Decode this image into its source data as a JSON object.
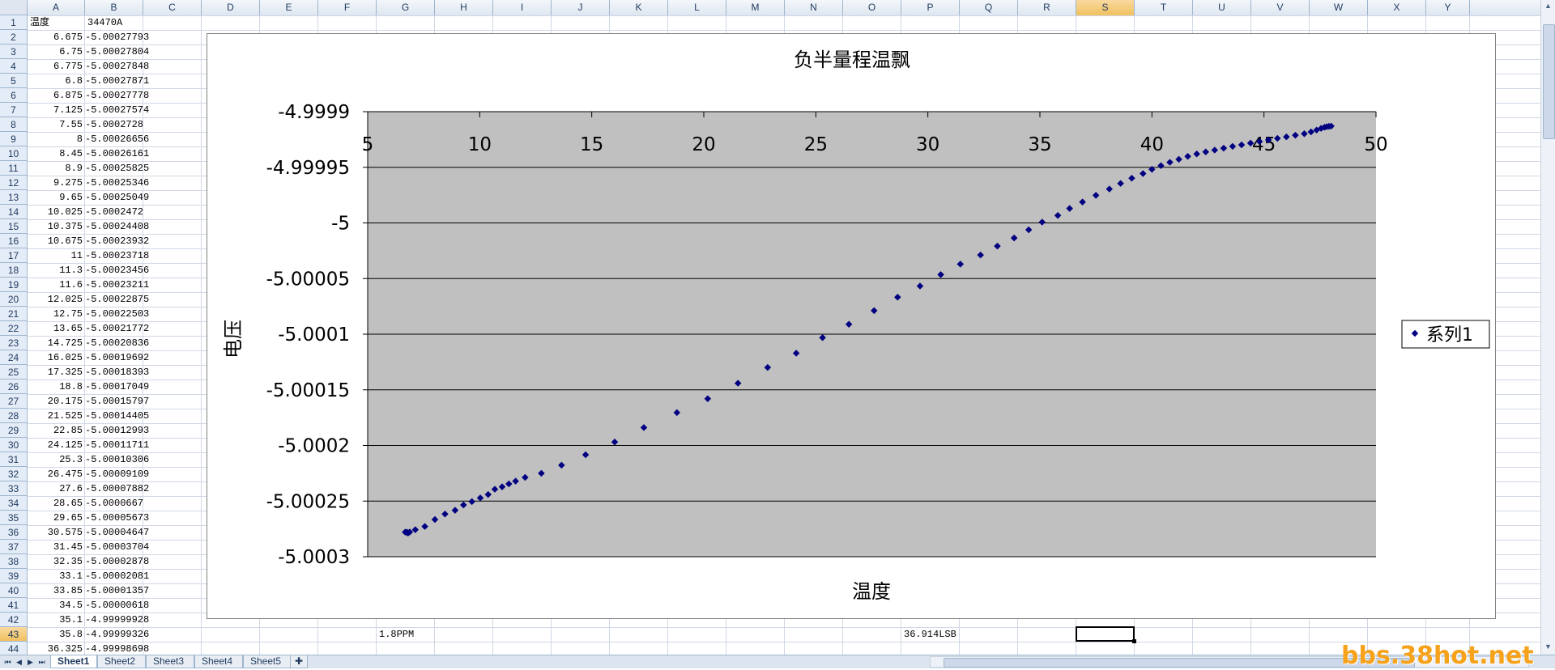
{
  "columns": [
    "A",
    "B",
    "C",
    "D",
    "E",
    "F",
    "G",
    "H",
    "I",
    "J",
    "K",
    "L",
    "M",
    "N",
    "O",
    "P",
    "Q",
    "R",
    "S",
    "T",
    "U",
    "V",
    "W",
    "X",
    "Y"
  ],
  "selected_column": "S",
  "selected_row": 43,
  "rows": [
    {
      "n": 1,
      "a": "温度",
      "b": "34470A"
    },
    {
      "n": 2,
      "a": "6.675",
      "b": "-5.00027793"
    },
    {
      "n": 3,
      "a": "6.75",
      "b": "-5.00027804"
    },
    {
      "n": 4,
      "a": "6.775",
      "b": "-5.00027848"
    },
    {
      "n": 5,
      "a": "6.8",
      "b": "-5.00027871"
    },
    {
      "n": 6,
      "a": "6.875",
      "b": "-5.00027778"
    },
    {
      "n": 7,
      "a": "7.125",
      "b": "-5.00027574"
    },
    {
      "n": 8,
      "a": "7.55",
      "b": "-5.0002728"
    },
    {
      "n": 9,
      "a": "8",
      "b": "-5.00026656"
    },
    {
      "n": 10,
      "a": "8.45",
      "b": "-5.00026161"
    },
    {
      "n": 11,
      "a": "8.9",
      "b": "-5.00025825"
    },
    {
      "n": 12,
      "a": "9.275",
      "b": "-5.00025346"
    },
    {
      "n": 13,
      "a": "9.65",
      "b": "-5.00025049"
    },
    {
      "n": 14,
      "a": "10.025",
      "b": "-5.0002472"
    },
    {
      "n": 15,
      "a": "10.375",
      "b": "-5.00024408"
    },
    {
      "n": 16,
      "a": "10.675",
      "b": "-5.00023932"
    },
    {
      "n": 17,
      "a": "11",
      "b": "-5.00023718"
    },
    {
      "n": 18,
      "a": "11.3",
      "b": "-5.00023456"
    },
    {
      "n": 19,
      "a": "11.6",
      "b": "-5.00023211"
    },
    {
      "n": 20,
      "a": "12.025",
      "b": "-5.00022875"
    },
    {
      "n": 21,
      "a": "12.75",
      "b": "-5.00022503"
    },
    {
      "n": 22,
      "a": "13.65",
      "b": "-5.00021772"
    },
    {
      "n": 23,
      "a": "14.725",
      "b": "-5.00020836"
    },
    {
      "n": 24,
      "a": "16.025",
      "b": "-5.00019692"
    },
    {
      "n": 25,
      "a": "17.325",
      "b": "-5.00018393"
    },
    {
      "n": 26,
      "a": "18.8",
      "b": "-5.00017049"
    },
    {
      "n": 27,
      "a": "20.175",
      "b": "-5.00015797"
    },
    {
      "n": 28,
      "a": "21.525",
      "b": "-5.00014405"
    },
    {
      "n": 29,
      "a": "22.85",
      "b": "-5.00012993"
    },
    {
      "n": 30,
      "a": "24.125",
      "b": "-5.00011711"
    },
    {
      "n": 31,
      "a": "25.3",
      "b": "-5.00010306"
    },
    {
      "n": 32,
      "a": "26.475",
      "b": "-5.00009109"
    },
    {
      "n": 33,
      "a": "27.6",
      "b": "-5.00007882"
    },
    {
      "n": 34,
      "a": "28.65",
      "b": "-5.0000667"
    },
    {
      "n": 35,
      "a": "29.65",
      "b": "-5.00005673"
    },
    {
      "n": 36,
      "a": "30.575",
      "b": "-5.00004647"
    },
    {
      "n": 37,
      "a": "31.45",
      "b": "-5.00003704"
    },
    {
      "n": 38,
      "a": "32.35",
      "b": "-5.00002878"
    },
    {
      "n": 39,
      "a": "33.1",
      "b": "-5.00002081"
    },
    {
      "n": 40,
      "a": "33.85",
      "b": "-5.00001357"
    },
    {
      "n": 41,
      "a": "34.5",
      "b": "-5.00000618"
    },
    {
      "n": 42,
      "a": "35.1",
      "b": "-4.99999928"
    },
    {
      "n": 43,
      "a": "35.8",
      "b": "-4.99999326"
    },
    {
      "n": 44,
      "a": "36.325",
      "b": "-4.99998698"
    }
  ],
  "extra_cells": {
    "g43": "1.8PPM",
    "p43": "36.914LSB"
  },
  "sheet_tabs": [
    "Sheet1",
    "Sheet2",
    "Sheet3",
    "Sheet4",
    "Sheet5"
  ],
  "active_sheet": "Sheet1",
  "watermark": "bbs.38hot.net",
  "chart_data": {
    "type": "scatter",
    "title": "负半量程温飘",
    "xlabel": "温度",
    "ylabel": "电压",
    "xlim": [
      5,
      50
    ],
    "ylim": [
      -5.0003,
      -4.9999
    ],
    "x_ticks": [
      "5",
      "10",
      "15",
      "20",
      "25",
      "30",
      "35",
      "40",
      "45",
      "50"
    ],
    "y_ticks": [
      "-4.9999",
      "-4.99995",
      "-5",
      "-5.00005",
      "-5.0001",
      "-5.00015",
      "-5.0002",
      "-5.00025",
      "-5.0003"
    ],
    "x_axis_position": "top",
    "grid": "horizontal",
    "plot_background": "#c0c0c0",
    "marker_color": "#000080",
    "legend": {
      "position": "right",
      "entries": [
        "系列1"
      ]
    },
    "series": [
      {
        "name": "系列1",
        "points": [
          [
            6.675,
            -5.00027793
          ],
          [
            6.75,
            -5.00027804
          ],
          [
            6.775,
            -5.00027848
          ],
          [
            6.8,
            -5.00027871
          ],
          [
            6.875,
            -5.00027778
          ],
          [
            7.125,
            -5.00027574
          ],
          [
            7.55,
            -5.0002728
          ],
          [
            8,
            -5.00026656
          ],
          [
            8.45,
            -5.00026161
          ],
          [
            8.9,
            -5.00025825
          ],
          [
            9.275,
            -5.00025346
          ],
          [
            9.65,
            -5.00025049
          ],
          [
            10.025,
            -5.0002472
          ],
          [
            10.375,
            -5.00024408
          ],
          [
            10.675,
            -5.00023932
          ],
          [
            11,
            -5.00023718
          ],
          [
            11.3,
            -5.00023456
          ],
          [
            11.6,
            -5.00023211
          ],
          [
            12.025,
            -5.00022875
          ],
          [
            12.75,
            -5.00022503
          ],
          [
            13.65,
            -5.00021772
          ],
          [
            14.725,
            -5.00020836
          ],
          [
            16.025,
            -5.00019692
          ],
          [
            17.325,
            -5.00018393
          ],
          [
            18.8,
            -5.00017049
          ],
          [
            20.175,
            -5.00015797
          ],
          [
            21.525,
            -5.00014405
          ],
          [
            22.85,
            -5.00012993
          ],
          [
            24.125,
            -5.00011711
          ],
          [
            25.3,
            -5.00010306
          ],
          [
            26.475,
            -5.00009109
          ],
          [
            27.6,
            -5.00007882
          ],
          [
            28.65,
            -5.0000667
          ],
          [
            29.65,
            -5.00005673
          ],
          [
            30.575,
            -5.00004647
          ],
          [
            31.45,
            -5.00003704
          ],
          [
            32.35,
            -5.00002878
          ],
          [
            33.1,
            -5.00002081
          ],
          [
            33.85,
            -5.00001357
          ],
          [
            34.5,
            -5.00000618
          ],
          [
            35.1,
            -4.99999928
          ],
          [
            35.8,
            -4.99999326
          ],
          [
            36.325,
            -4.99998698
          ],
          [
            36.9,
            -4.9999812
          ],
          [
            37.5,
            -4.9999752
          ],
          [
            38.1,
            -4.9999695
          ],
          [
            38.6,
            -4.9999645
          ],
          [
            39.1,
            -4.9999598
          ],
          [
            39.6,
            -4.9999556
          ],
          [
            40.0,
            -4.9999518
          ],
          [
            40.4,
            -4.9999485
          ],
          [
            40.8,
            -4.9999455
          ],
          [
            41.2,
            -4.9999428
          ],
          [
            41.6,
            -4.9999402
          ],
          [
            42.0,
            -4.999938
          ],
          [
            42.4,
            -4.9999362
          ],
          [
            42.8,
            -4.9999345
          ],
          [
            43.2,
            -4.9999328
          ],
          [
            43.6,
            -4.9999312
          ],
          [
            44.0,
            -4.9999298
          ],
          [
            44.4,
            -4.9999283
          ],
          [
            44.8,
            -4.9999268
          ],
          [
            45.2,
            -4.9999254
          ],
          [
            45.6,
            -4.999924
          ],
          [
            46.0,
            -4.9999226
          ],
          [
            46.4,
            -4.9999212
          ],
          [
            46.8,
            -4.9999198
          ],
          [
            47.1,
            -4.9999182
          ],
          [
            47.35,
            -4.9999165
          ],
          [
            47.55,
            -4.999915
          ],
          [
            47.7,
            -4.999914
          ],
          [
            47.8,
            -4.9999135
          ],
          [
            47.9,
            -4.9999132
          ],
          [
            48.0,
            -4.999913
          ]
        ]
      }
    ]
  }
}
